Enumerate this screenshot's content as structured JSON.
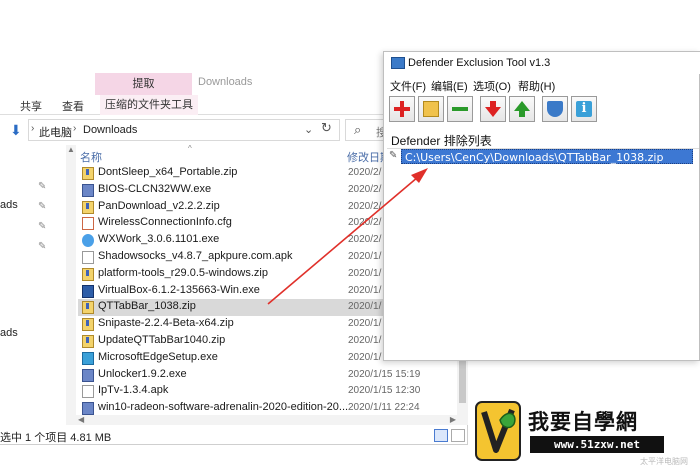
{
  "explorer": {
    "context_tab": "提取",
    "window_title": "Downloads",
    "ribbon_tabs": [
      "共享",
      "查看",
      "压缩的文件夹工具"
    ],
    "breadcrumb": [
      "此电脑",
      "Downloads"
    ],
    "search_placeholder": "搜",
    "nav_items": [
      "ads",
      "ads"
    ],
    "col_name": "名称",
    "col_date": "修改日期",
    "files": [
      {
        "name": "DontSleep_x64_Portable.zip",
        "date": "2020/2/",
        "icon": "zip"
      },
      {
        "name": "BIOS-CLCN32WW.exe",
        "date": "2020/2/",
        "icon": "exe"
      },
      {
        "name": "PanDownload_v2.2.2.zip",
        "date": "2020/2/",
        "icon": "zip"
      },
      {
        "name": "WirelessConnectionInfo.cfg",
        "date": "2020/2/",
        "icon": "cfg"
      },
      {
        "name": "WXWork_3.0.6.1101.exe",
        "date": "2020/2/",
        "icon": "wx"
      },
      {
        "name": "Shadowsocks_v4.8.7_apkpure.com.apk",
        "date": "2020/1/",
        "icon": "apk"
      },
      {
        "name": "platform-tools_r29.0.5-windows.zip",
        "date": "2020/1/",
        "icon": "zip"
      },
      {
        "name": "VirtualBox-6.1.2-135663-Win.exe",
        "date": "2020/1/",
        "icon": "vbox"
      },
      {
        "name": "QTTabBar_1038.zip",
        "date": "2020/1/",
        "icon": "zip",
        "selected": true
      },
      {
        "name": "Snipaste-2.2.4-Beta-x64.zip",
        "date": "2020/1/",
        "icon": "zip"
      },
      {
        "name": "UpdateQTTabBar1040.zip",
        "date": "2020/1/",
        "icon": "zip"
      },
      {
        "name": "MicrosoftEdgeSetup.exe",
        "date": "2020/1/",
        "icon": "edge"
      },
      {
        "name": "Unlocker1.9.2.exe",
        "date": "2020/1/15 15:19",
        "icon": "exe"
      },
      {
        "name": "IpTv-1.3.4.apk",
        "date": "2020/1/15 12:30",
        "icon": "apk"
      },
      {
        "name": "win10-radeon-software-adrenalin-2020-edition-20...",
        "date": "2020/1/11 22:24",
        "icon": "exe"
      }
    ],
    "status": "选中 1 个项目  4.81 MB"
  },
  "tool": {
    "title": "Defender Exclusion Tool v1.3",
    "menu": [
      "文件(F)",
      "编辑(E)",
      "选项(O)",
      "帮助(H)"
    ],
    "list_title": "Defender 排除列表",
    "entries": [
      "C:\\Users\\CenCy\\Downloads\\QTTabBar_1038.zip"
    ]
  },
  "watermark": {
    "title": "我要自學網",
    "url": "www.51zxw.net",
    "sub": "太平洋电脑网"
  },
  "colors": {
    "selection_blue": "#3d78d3",
    "context_tab": "#f5d6e6",
    "arrow_red": "#e0302a"
  }
}
